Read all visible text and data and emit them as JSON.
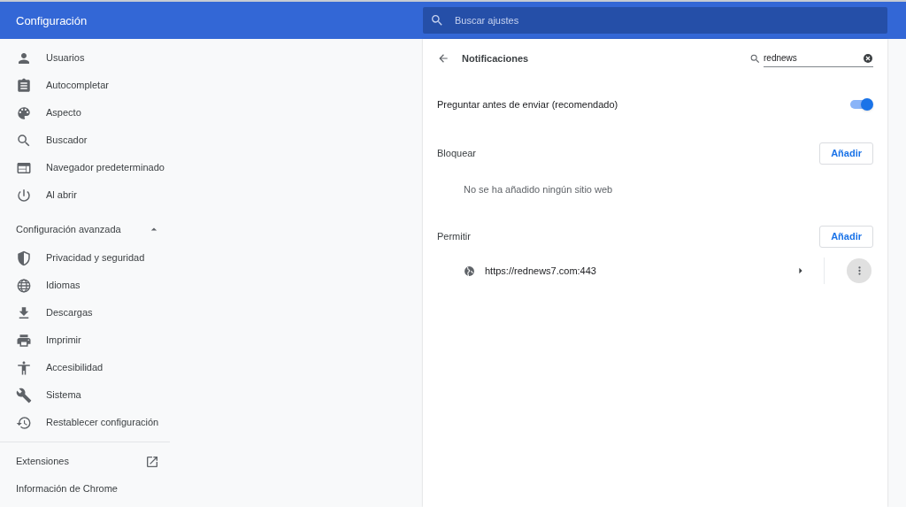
{
  "header": {
    "title": "Configuración",
    "search": {
      "placeholder": "Buscar ajustes"
    }
  },
  "sidebar": {
    "items": [
      {
        "label": "Usuarios",
        "selected": false
      },
      {
        "label": "Autocompletar",
        "selected": false
      },
      {
        "label": "Aspecto",
        "selected": false
      },
      {
        "label": "Buscador",
        "selected": false
      },
      {
        "label": "Navegador predeterminado",
        "selected": false
      },
      {
        "label": "Al abrir",
        "selected": false
      }
    ],
    "advanced": {
      "label": "Configuración avanzada",
      "expanded": true,
      "items": [
        {
          "label": "Privacidad y seguridad",
          "selected": false
        },
        {
          "label": "Idiomas",
          "selected": false
        },
        {
          "label": "Descargas",
          "selected": false
        },
        {
          "label": "Imprimir",
          "selected": false
        },
        {
          "label": "Accesibilidad",
          "selected": false
        },
        {
          "label": "Sistema",
          "selected": false
        },
        {
          "label": "Restablecer configuración",
          "selected": false
        }
      ]
    },
    "footer": [
      {
        "label": "Extensiones",
        "kind": "external"
      },
      {
        "label": "Información de Chrome",
        "kind": "plain"
      }
    ]
  },
  "page": {
    "title": "Notificaciones",
    "filter": {
      "value": "rednews"
    },
    "toggle": {
      "label": "Preguntar antes de enviar (recomendado)",
      "on": true
    },
    "sections": [
      {
        "title": "Bloquear",
        "button": "Añadir",
        "empty": "No se ha añadido ningún sitio web"
      },
      {
        "title": "Permitir",
        "button": "Añadir",
        "sites": [
          {
            "url": "https://rednews7.com:443"
          }
        ]
      }
    ]
  }
}
